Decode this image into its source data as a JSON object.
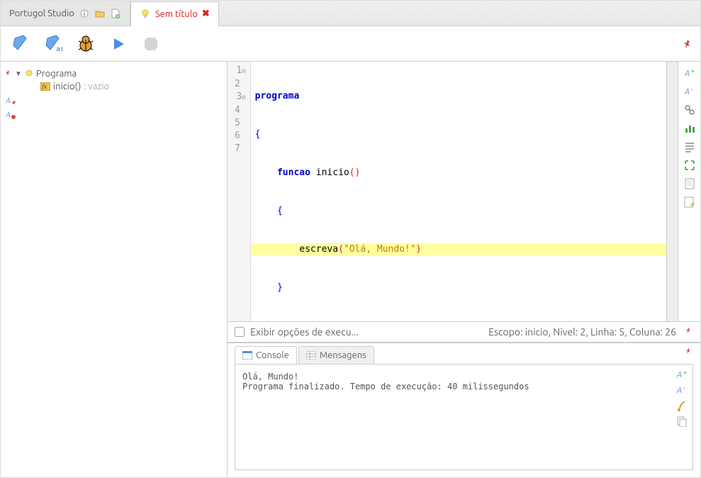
{
  "tabs": {
    "studio": "Portugol Studio",
    "file": "Sem título"
  },
  "tree": {
    "program": "Programa",
    "func": "inicio()",
    "type": "vazio"
  },
  "code": {
    "l1_kw": "programa",
    "l2": "{",
    "l3_kw": "funcao",
    "l3_fn": " inicio",
    "l3_p": "()",
    "l4": "{",
    "l5_fn": "escreva",
    "l5_p1": "(",
    "l5_str": "\"Olá, Mundo!\"",
    "l5_p2": ")",
    "l6": "}",
    "l7": "}"
  },
  "gutter": [
    "1",
    "2",
    "3",
    "4",
    "5",
    "6",
    "7"
  ],
  "status": {
    "exec_opts": "Exibir opções de execu...",
    "info": "Escopo: inicio, Nivel: 2, Linha: 5, Coluna: 26"
  },
  "console": {
    "tab1": "Console",
    "tab2": "Mensagens",
    "line1": "Olá, Mundo!",
    "line2": "Programa finalizado. Tempo de execução: 40 milissegundos"
  }
}
